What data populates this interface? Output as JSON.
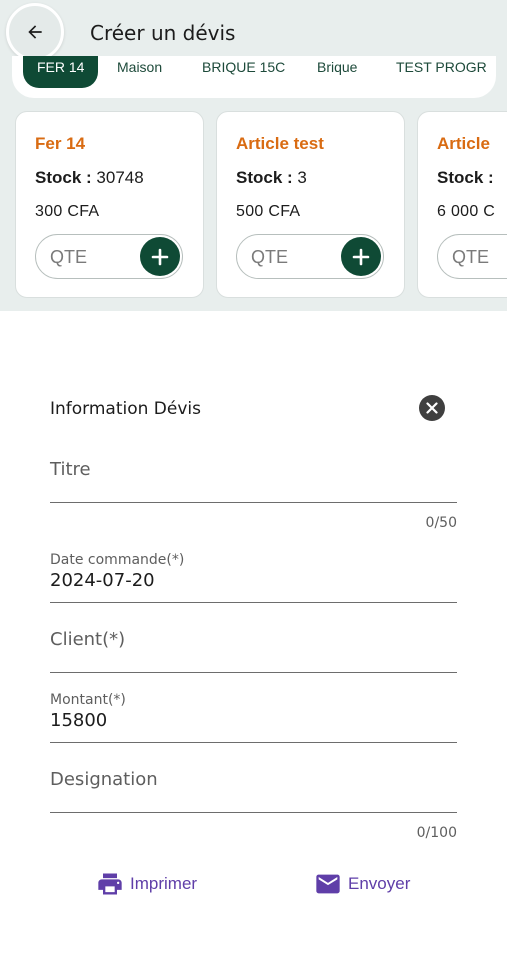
{
  "header": {
    "title": "Créer un dévis",
    "back_icon": "arrow-left-icon"
  },
  "categories": [
    {
      "label": "FER 14",
      "active": true
    },
    {
      "label": "Maison",
      "active": false
    },
    {
      "label": "BRIQUE 15C",
      "active": false
    },
    {
      "label": "Brique",
      "active": false
    },
    {
      "label": "TEST PROGR",
      "active": false
    }
  ],
  "products": [
    {
      "name": "Fer 14",
      "stock_label": "Stock :",
      "stock": "30748",
      "price": "300 CFA",
      "qte_placeholder": "QTE"
    },
    {
      "name": "Article test",
      "stock_label": "Stock :",
      "stock": "3",
      "price": "500 CFA",
      "qte_placeholder": "QTE"
    },
    {
      "name": "Article",
      "stock_label": "Stock :",
      "stock": "",
      "price": "6 000 C",
      "qte_placeholder": "QTE"
    }
  ],
  "form": {
    "header": "Information Dévis",
    "close_icon": "close-icon",
    "title_placeholder": "Titre",
    "title_counter": "0/50",
    "date_label": "Date commande(*)",
    "date_value": "2024-07-20",
    "client_placeholder": "Client(*)",
    "amount_label": "Montant(*)",
    "amount_value": "15800",
    "designation_placeholder": "Designation",
    "designation_counter": "0/100"
  },
  "actions": {
    "print_label": "Imprimer",
    "print_icon": "printer-icon",
    "send_label": "Envoyer",
    "send_icon": "mail-icon"
  },
  "colors": {
    "primary": "#0f4a35",
    "accent_orange": "#d96b12",
    "action_purple": "#5f3ea8",
    "top_background": "#e8eeed"
  }
}
